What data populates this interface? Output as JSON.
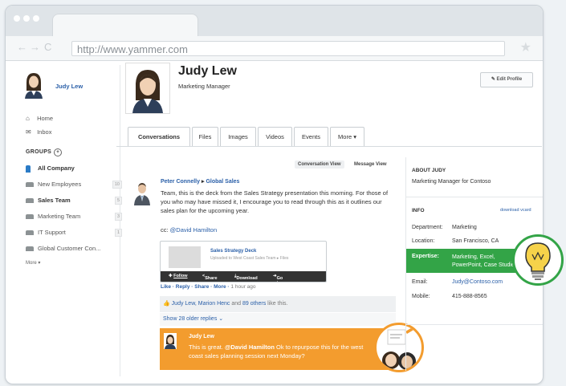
{
  "browser": {
    "url": "http://www.yammer.com"
  },
  "sidebar": {
    "user_name": "Judy Lew",
    "nav": [
      {
        "label": "Home",
        "icon": "home-icon"
      },
      {
        "label": "Inbox",
        "icon": "inbox-icon"
      }
    ],
    "groups_title": "GROUPS",
    "groups": [
      {
        "label": "All Company",
        "count": "",
        "active": true
      },
      {
        "label": "New Employees",
        "count": "10",
        "active": false
      },
      {
        "label": "Sales Team",
        "count": "5",
        "active": true
      },
      {
        "label": "Marketing Team",
        "count": "3",
        "active": false
      },
      {
        "label": "IT Support",
        "count": "1",
        "active": false
      },
      {
        "label": "Global Customer Con...",
        "count": "",
        "active": false
      }
    ],
    "more_label": "More ▾"
  },
  "profile": {
    "name": "Judy Lew",
    "title": "Marketing Manager",
    "edit_label": "Edit Profile"
  },
  "tabs": [
    "Conversations",
    "Files",
    "Images",
    "Videos",
    "Events",
    "More ▾"
  ],
  "views": {
    "conversation": "Conversation View",
    "message": "Message View"
  },
  "post": {
    "author": "Peter Connelly",
    "group": "Global Sales",
    "body": "Team, this is the deck from the Sales Strategy presentation this morning. For those of you who may have missed it, I encourage you to read through this as it outlines our sales plan for the upcoming year.",
    "cc_prefix": "cc: ",
    "cc_mention": "@David Hamilton",
    "attachment": {
      "title": "Sales Strategy Deck",
      "subtitle": "Uploaded to West Coast Sales Team ▸ Files",
      "follow": "Follow",
      "share": "Share",
      "download": "Download",
      "goto": "Go to File"
    },
    "actions": "Like · Reply · Share · More ·",
    "time": "1 hour ago",
    "likers": "Judy Lew, Marion Henc",
    "likes_and": "and",
    "likes_others": "89 others",
    "likes_suffix": "like this.",
    "older_replies": "Show 28 older replies ⌄"
  },
  "reply": {
    "author": "Judy Lew",
    "prefix": "This is great. ",
    "mention": "@David Hamilton",
    "text": " Ok to repurpose this for the west coast sales planning session next Monday?"
  },
  "about": {
    "heading": "ABOUT JUDY",
    "text": "Marketing Manager for Contoso"
  },
  "info": {
    "heading": "INFO",
    "download_vcard": "download vcard",
    "rows": [
      {
        "key": "Department:",
        "value": "Marketing"
      },
      {
        "key": "Location:",
        "value": "San Francisco, CA"
      },
      {
        "key": "Expertise:",
        "value": "Marketing, Excel, PowerPoint, Case Studies, Customer"
      },
      {
        "key": "Email:",
        "value": "Judy@Contoso.com"
      },
      {
        "key": "Mobile:",
        "value": "415-888-8565"
      }
    ]
  },
  "colors": {
    "link": "#2a5fa8",
    "reply_bg": "#f39c2e",
    "expertise_bg": "#33a447"
  }
}
